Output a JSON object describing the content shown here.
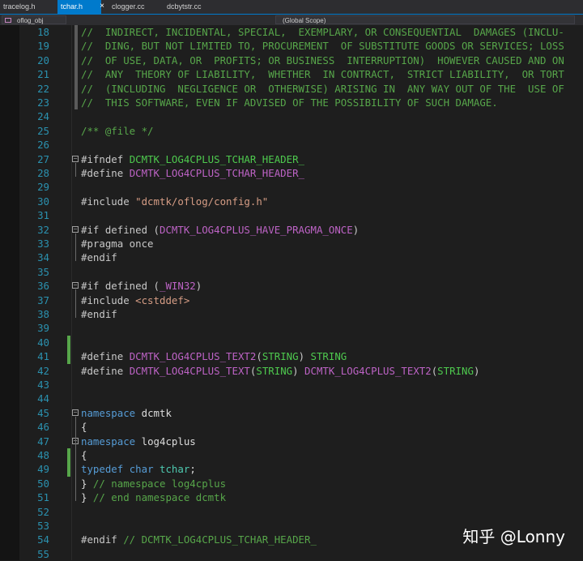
{
  "tabs": [
    {
      "label": "tracelog.h",
      "active": false
    },
    {
      "label": "tchar.h",
      "active": true
    },
    {
      "label": "clogger.cc",
      "active": false
    },
    {
      "label": "dcbytstr.cc",
      "active": false
    }
  ],
  "tab_close_glyph": "×",
  "nav": {
    "project": "oflog_obj",
    "scope": "(Global Scope)"
  },
  "watermark": "知乎 @Lonny",
  "lines": [
    {
      "n": "18",
      "tokens": [
        [
          "com",
          "//  INDIRECT, INCIDENTAL, SPECIAL,  EXEMPLARY, OR CONSEQUENTIAL  DAMAGES (INCLU-"
        ]
      ]
    },
    {
      "n": "19",
      "tokens": [
        [
          "com",
          "//  DING, BUT NOT LIMITED TO, PROCUREMENT  OF SUBSTITUTE GOODS OR SERVICES; LOSS"
        ]
      ]
    },
    {
      "n": "20",
      "tokens": [
        [
          "com",
          "//  OF USE, DATA, OR  PROFITS; OR BUSINESS  INTERRUPTION)  HOWEVER CAUSED AND ON"
        ]
      ]
    },
    {
      "n": "21",
      "tokens": [
        [
          "com",
          "//  ANY  THEORY OF LIABILITY,  WHETHER  IN CONTRACT,  STRICT LIABILITY,  OR TORT"
        ]
      ]
    },
    {
      "n": "22",
      "tokens": [
        [
          "com",
          "//  (INCLUDING  NEGLIGENCE OR  OTHERWISE) ARISING IN  ANY WAY OUT OF THE  USE OF"
        ]
      ]
    },
    {
      "n": "23",
      "tokens": [
        [
          "com",
          "//  THIS SOFTWARE, EVEN IF ADVISED OF THE POSSIBILITY OF SUCH DAMAGE."
        ]
      ]
    },
    {
      "n": "24",
      "tokens": []
    },
    {
      "n": "25",
      "tokens": [
        [
          "com",
          "/** @file */"
        ]
      ]
    },
    {
      "n": "26",
      "tokens": []
    },
    {
      "n": "27",
      "tokens": [
        [
          "pp",
          "#ifndef "
        ],
        [
          "mgreen",
          "DCMTK_LOG4CPLUS_TCHAR_HEADER_"
        ]
      ]
    },
    {
      "n": "28",
      "tokens": [
        [
          "pp",
          "#define "
        ],
        [
          "macro",
          "DCMTK_LOG4CPLUS_TCHAR_HEADER_"
        ]
      ]
    },
    {
      "n": "29",
      "tokens": []
    },
    {
      "n": "30",
      "tokens": [
        [
          "pp",
          "#include "
        ],
        [
          "str",
          "\"dcmtk/oflog/config.h\""
        ]
      ]
    },
    {
      "n": "31",
      "tokens": []
    },
    {
      "n": "32",
      "tokens": [
        [
          "pp",
          "#if defined ("
        ],
        [
          "macro",
          "DCMTK_LOG4CPLUS_HAVE_PRAGMA_ONCE"
        ],
        [
          "pp",
          ")"
        ]
      ]
    },
    {
      "n": "33",
      "tokens": [
        [
          "pp",
          "#pragma once"
        ]
      ]
    },
    {
      "n": "34",
      "tokens": [
        [
          "pp",
          "#endif"
        ]
      ]
    },
    {
      "n": "35",
      "tokens": []
    },
    {
      "n": "36",
      "tokens": [
        [
          "pp",
          "#if defined ("
        ],
        [
          "macro",
          "_WIN32"
        ],
        [
          "pp",
          ")"
        ]
      ]
    },
    {
      "n": "37",
      "tokens": [
        [
          "pp",
          "#include "
        ],
        [
          "str",
          "<cstddef>"
        ]
      ]
    },
    {
      "n": "38",
      "tokens": [
        [
          "pp",
          "#endif"
        ]
      ]
    },
    {
      "n": "39",
      "tokens": []
    },
    {
      "n": "40",
      "tokens": []
    },
    {
      "n": "41",
      "tokens": [
        [
          "pp",
          "#define "
        ],
        [
          "macro",
          "DCMTK_LOG4CPLUS_TEXT2"
        ],
        [
          "pp",
          "("
        ],
        [
          "mgreen",
          "STRING"
        ],
        [
          "pp",
          ") "
        ],
        [
          "mgreen",
          "STRING"
        ]
      ]
    },
    {
      "n": "42",
      "tokens": [
        [
          "pp",
          "#define "
        ],
        [
          "macro",
          "DCMTK_LOG4CPLUS_TEXT"
        ],
        [
          "pp",
          "("
        ],
        [
          "mgreen",
          "STRING"
        ],
        [
          "pp",
          ") "
        ],
        [
          "macro",
          "DCMTK_LOG4CPLUS_TEXT2"
        ],
        [
          "pp",
          "("
        ],
        [
          "mgreen",
          "STRING"
        ],
        [
          "pp",
          ")"
        ]
      ]
    },
    {
      "n": "43",
      "tokens": []
    },
    {
      "n": "44",
      "tokens": []
    },
    {
      "n": "45",
      "tokens": [
        [
          "kw",
          "namespace "
        ],
        [
          "plain",
          "dcmtk"
        ]
      ]
    },
    {
      "n": "46",
      "tokens": [
        [
          "plain",
          "{"
        ]
      ]
    },
    {
      "n": "47",
      "tokens": [
        [
          "kw",
          "namespace "
        ],
        [
          "plain",
          "log4cplus"
        ]
      ]
    },
    {
      "n": "48",
      "tokens": [
        [
          "plain",
          "{"
        ]
      ]
    },
    {
      "n": "49",
      "tokens": [
        [
          "kw",
          "typedef "
        ],
        [
          "kw",
          "char "
        ],
        [
          "type",
          "tchar"
        ],
        [
          "plain",
          ";"
        ]
      ]
    },
    {
      "n": "50",
      "tokens": [
        [
          "plain",
          "} "
        ],
        [
          "com",
          "// namespace log4cplus"
        ]
      ]
    },
    {
      "n": "51",
      "tokens": [
        [
          "plain",
          "} "
        ],
        [
          "com",
          "// end namespace dcmtk"
        ]
      ]
    },
    {
      "n": "52",
      "tokens": []
    },
    {
      "n": "53",
      "tokens": []
    },
    {
      "n": "54",
      "tokens": [
        [
          "pp",
          "#endif "
        ],
        [
          "com",
          "// DCMTK_LOG4CPLUS_TCHAR_HEADER_"
        ]
      ]
    },
    {
      "n": "55",
      "tokens": []
    }
  ]
}
